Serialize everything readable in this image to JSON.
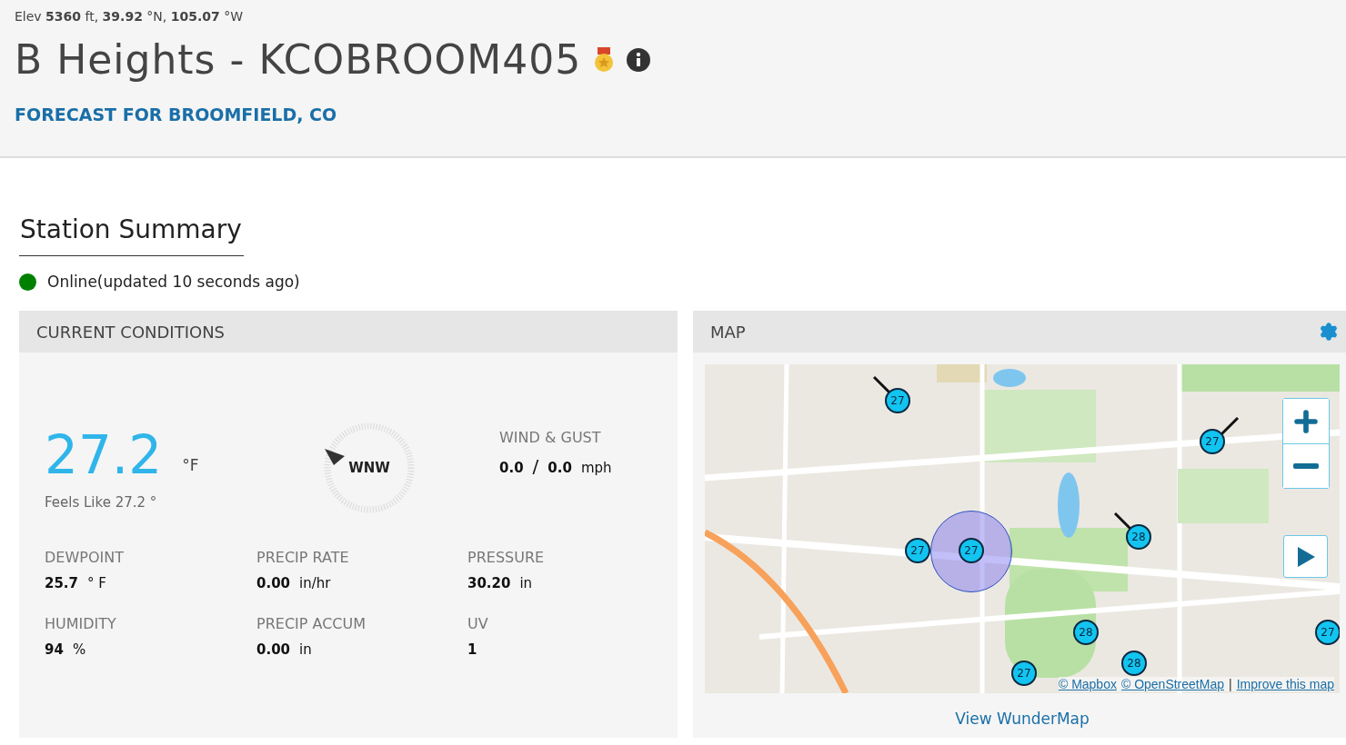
{
  "header": {
    "elevation": "Elev **5360** ft, **39.92** °N, **105.07** °W",
    "title": "B Heights - KCOBROOM405",
    "forecast_link": "FORECAST FOR BROOMFIELD, CO"
  },
  "summary": {
    "title": "Station Summary",
    "status": {
      "color": "#008000",
      "label": "Online",
      "detail": "(updated 10 seconds ago)"
    }
  },
  "current_conditions": {
    "title": "CURRENT CONDITIONS",
    "temperature": "27.2",
    "temp_unit": "°F",
    "feels_like": "Feels Like 27.2 °",
    "wind_direction": "WNW",
    "wind_label": "WIND & GUST",
    "wind_speed": "0.0",
    "wind_sep": "/",
    "wind_gust": "0.0",
    "wind_unit": "mph",
    "metrics": [
      {
        "label": "DEWPOINT",
        "value": "25.7",
        "unit": "° F"
      },
      {
        "label": "PRECIP RATE",
        "value": "0.00",
        "unit": "in/hr"
      },
      {
        "label": "PRESSURE",
        "value": "30.20",
        "unit": "in"
      },
      {
        "label": "HUMIDITY",
        "value": "94",
        "unit": "%"
      },
      {
        "label": "PRECIP ACCUM",
        "value": "0.00",
        "unit": "in"
      },
      {
        "label": "UV",
        "value": "1"
      }
    ]
  },
  "map": {
    "title": "MAP",
    "markers": [
      {
        "label": "27",
        "kind": "wind"
      },
      {
        "label": "27",
        "kind": "wind"
      },
      {
        "label": "28",
        "kind": "wind"
      },
      {
        "label": "27",
        "kind": "plain"
      },
      {
        "label": "27",
        "kind": "plain"
      },
      {
        "label": "28",
        "kind": "plain"
      },
      {
        "label": "28",
        "kind": "plain"
      },
      {
        "label": "27",
        "kind": "plain"
      },
      {
        "label": "27",
        "kind": "plain"
      }
    ],
    "attribution": [
      {
        "text": "© Mapbox",
        "kind": "link"
      },
      {
        "text": "© OpenStreetMap",
        "kind": "link"
      },
      {
        "text": "|",
        "kind": "separator"
      },
      {
        "text": "Improve this map",
        "kind": "link"
      }
    ],
    "view_link": "View WunderMap"
  }
}
